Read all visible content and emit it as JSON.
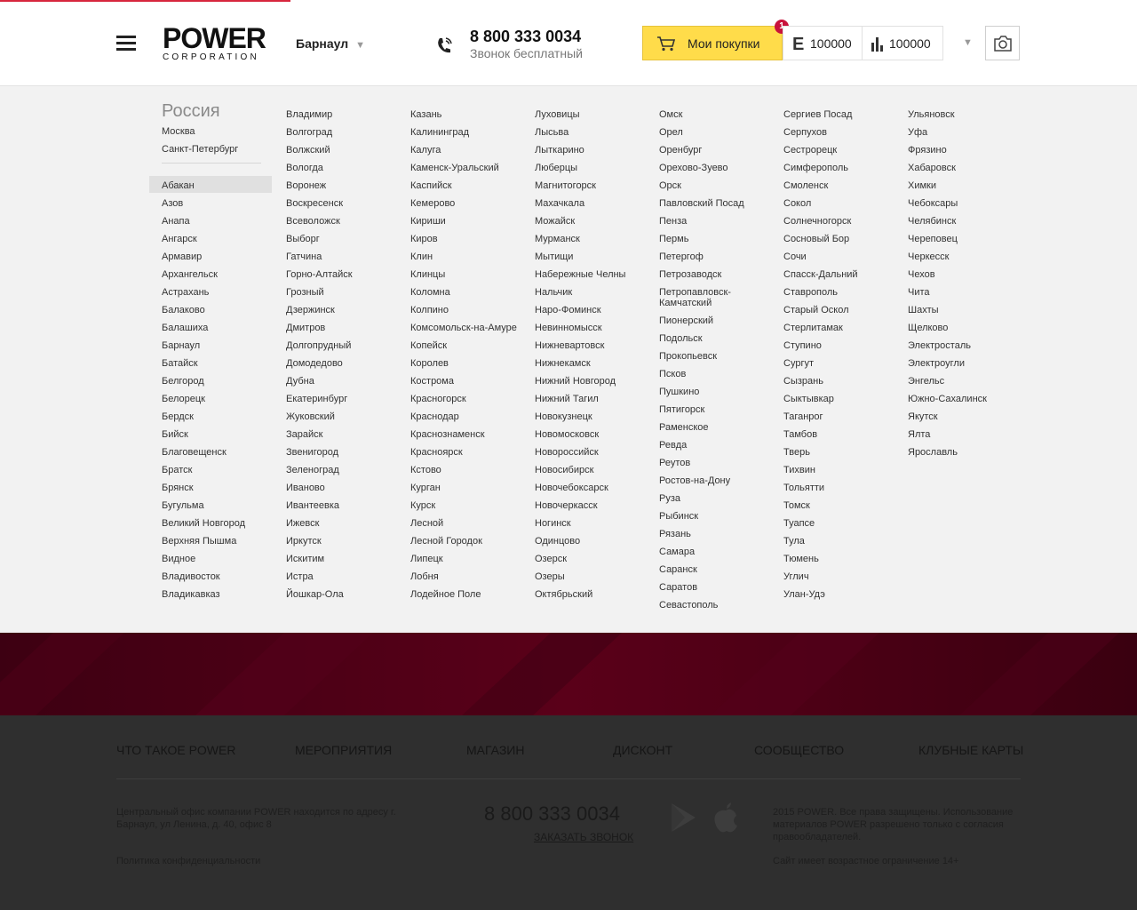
{
  "header": {
    "logo": {
      "main": "POWER",
      "sub": "CORPORATION"
    },
    "city": "Барнаул",
    "phone": {
      "number": "8 800 333 0034",
      "note": "Звонок бесплатный"
    },
    "cart": {
      "label": "Мои покупки",
      "badge": "1"
    },
    "counters": [
      {
        "icon": "E",
        "value": "100000"
      },
      {
        "icon": "bars",
        "value": "100000"
      }
    ],
    "accent_color": "#d7263d",
    "cart_color": "#ffdc4a"
  },
  "cities": {
    "region": "Россия",
    "featured": [
      "Москва",
      "Санкт-Петербург"
    ],
    "selected": "Абакан",
    "columns": [
      [
        "Абакан",
        "Азов",
        "Анапа",
        "Ангарск",
        "Армавир",
        "Архангельск",
        "Астрахань",
        "Балаково",
        "Балашиха",
        "Барнаул",
        "Батайск",
        "Белгород",
        "Белорецк",
        "Бердск",
        "Бийск",
        "Благовещенск",
        "Братск",
        "Брянск",
        "Бугульма",
        "Великий Новгород",
        "Верхняя Пышма",
        "Видное",
        "Владивосток",
        "Владикавказ"
      ],
      [
        "Владимир",
        "Волгоград",
        "Волжский",
        "Вологда",
        "Воронеж",
        "Воскресенск",
        "Всеволожск",
        "Выборг",
        "Гатчина",
        "Горно-Алтайск",
        "Грозный",
        "Дзержинск",
        "Дмитров",
        "Долгопрудный",
        "Домодедово",
        "Дубна",
        "Екатеринбург",
        "Жуковский",
        "Зарайск",
        "Звенигород",
        "Зеленоград",
        "Иваново",
        "Ивантеевка",
        "Ижевск",
        "Иркутск",
        "Искитим",
        "Истра",
        "Йошкар-Ола"
      ],
      [
        "Казань",
        "Калининград",
        "Калуга",
        "Каменск-Уральский",
        "Каспийск",
        "Кемерово",
        "Кириши",
        "Киров",
        "Клин",
        "Клинцы",
        "Коломна",
        "Колпино",
        "Комсомольск-на-Амуре",
        "Копейск",
        "Королев",
        "Кострома",
        "Красногорск",
        "Краснодар",
        "Краснознаменск",
        "Красноярск",
        "Кстово",
        "Курган",
        "Курск",
        "Лесной",
        "Лесной Городок",
        "Липецк",
        "Лобня",
        "Лодейное Поле"
      ],
      [
        "Луховицы",
        "Лысьва",
        "Лыткарино",
        "Люберцы",
        "Магнитогорск",
        "Махачкала",
        "Можайск",
        "Мурманск",
        "Мытищи",
        "Набережные Челны",
        "Нальчик",
        "Наро-Фоминск",
        "Невинномысск",
        "Нижневартовск",
        "Нижнекамск",
        "Нижний Новгород",
        "Нижний Тагил",
        "Новокузнецк",
        "Новомосковск",
        "Новороссийск",
        "Новосибирск",
        "Новочебоксарск",
        "Новочеркасск",
        "Ногинск",
        "Одинцово",
        "Озерск",
        "Озеры",
        "Октябрьский"
      ],
      [
        "Омск",
        "Орел",
        "Оренбург",
        "Орехово-Зуево",
        "Орск",
        "Павловский Посад",
        "Пенза",
        "Пермь",
        "Петергоф",
        "Петрозаводск",
        "Петропавловск-Камчатский",
        "Пионерский",
        "Подольск",
        "Прокопьевск",
        "Псков",
        "Пушкино",
        "Пятигорск",
        "Раменское",
        "Ревда",
        "Реутов",
        "Ростов-на-Дону",
        "Руза",
        "Рыбинск",
        "Рязань",
        "Самара",
        "Саранск",
        "Саратов",
        "Севастополь"
      ],
      [
        "Сергиев Посад",
        "Серпухов",
        "Сестрорецк",
        "Симферополь",
        "Смоленск",
        "Сокол",
        "Солнечногорск",
        "Сосновый Бор",
        "Сочи",
        "Спасск-Дальний",
        "Ставрополь",
        "Старый Оскол",
        "Стерлитамак",
        "Ступино",
        "Сургут",
        "Сызрань",
        "Сыктывкар",
        "Таганрог",
        "Тамбов",
        "Тверь",
        "Тихвин",
        "Тольятти",
        "Томск",
        "Туапсе",
        "Тула",
        "Тюмень",
        "Углич",
        "Улан-Удэ"
      ],
      [
        "Ульяновск",
        "Уфа",
        "Фрязино",
        "Хабаровск",
        "Химки",
        "Чебоксары",
        "Челябинск",
        "Череповец",
        "Черкесск",
        "Чехов",
        "Чита",
        "Шахты",
        "Щелково",
        "Электросталь",
        "Электроугли",
        "Энгельс",
        "Южно-Сахалинск",
        "Якутск",
        "Ялта",
        "Ярославль"
      ]
    ]
  },
  "footer": {
    "nav": [
      "ЧТО ТАКОЕ POWER",
      "МЕРОПРИЯТИЯ",
      "МАГАЗИН",
      "ДИСКОНТ",
      "СООБЩЕСТВО",
      "КЛУБНЫЕ КАРТЫ"
    ],
    "address": "Центральный офис компании POWER находится по адресу г. Барнаул, ул Ленина, д. 40, офис 8",
    "privacy": "Политика конфиденциальности",
    "phone": "8 800 333 0034",
    "callback": "ЗАКАЗАТЬ ЗВОНОК",
    "copyright": "2015 POWER. Все права защищены. Использование материалов POWER разрешено только с согласия правообладателей.",
    "age": "Сайт имеет возрастное ограничение 14+",
    "band_color": "#3b0011"
  }
}
